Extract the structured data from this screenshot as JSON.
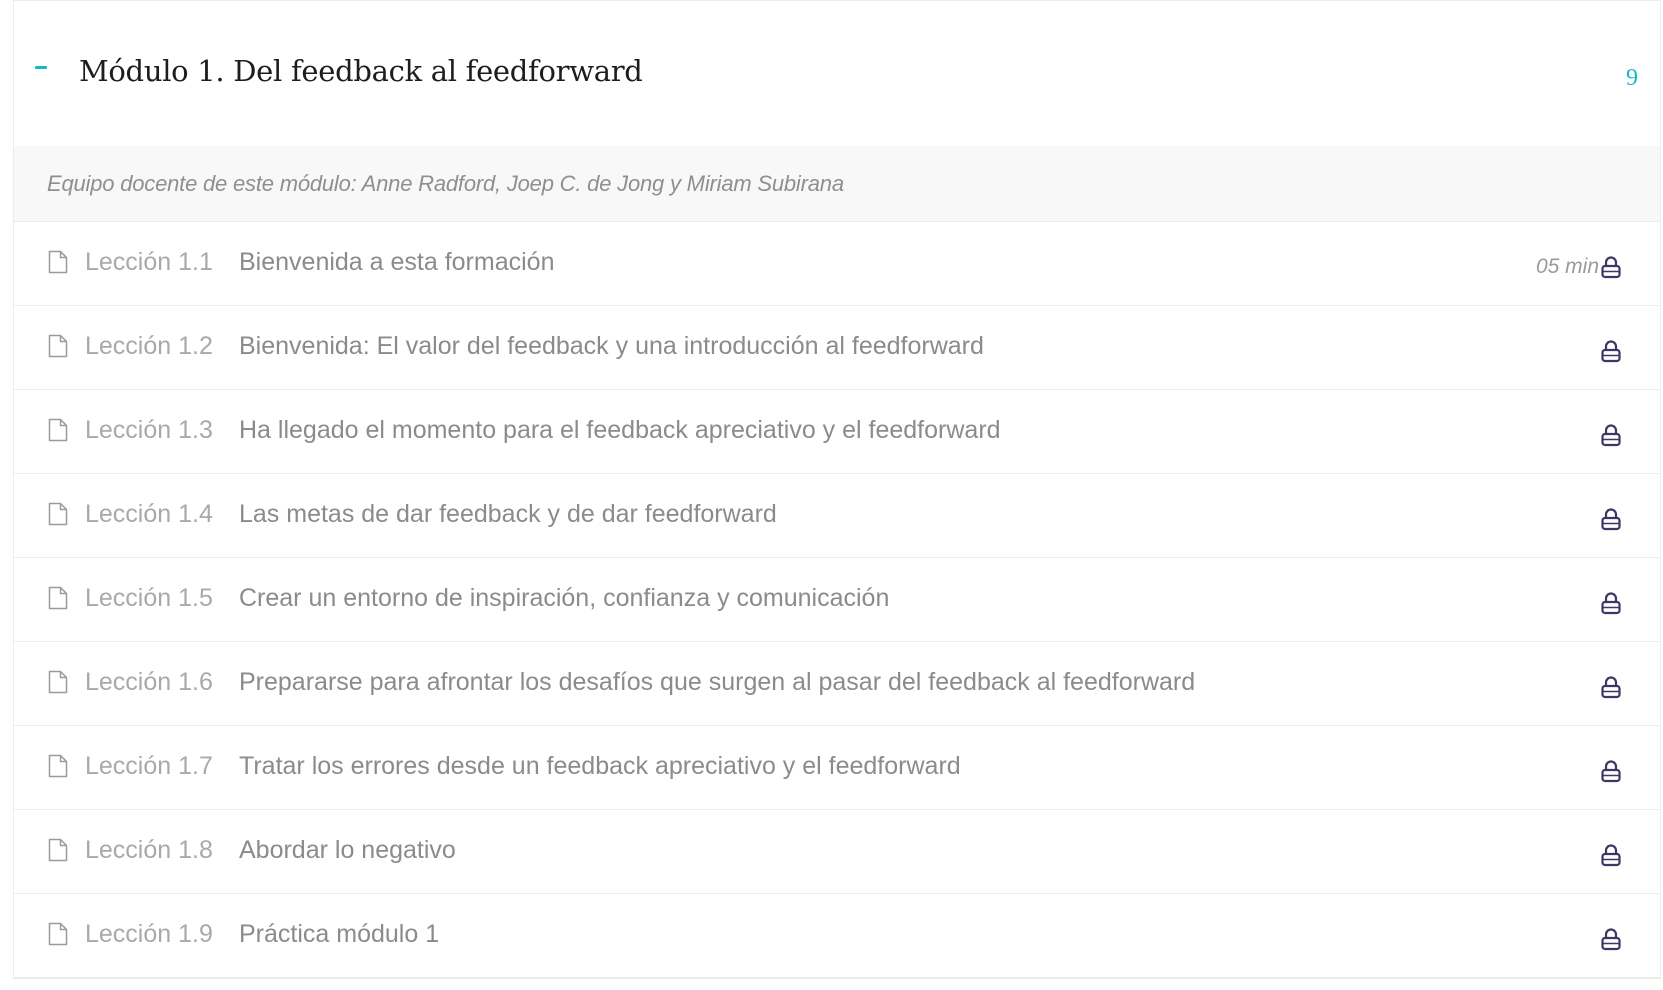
{
  "module": {
    "title": "Módulo 1. Del feedback al feedforward",
    "lesson_count": "9",
    "instructors": "Equipo docente de este módulo: Anne Radford, Joep C. de Jong y Miriam Subirana",
    "accent_color": "#17b7c8",
    "lessons": [
      {
        "label": "Lección 1.1",
        "title": "Bienvenida a esta formación",
        "duration": "05 min",
        "icon": "document-icon",
        "status_icon": "lock-icon"
      },
      {
        "label": "Lección 1.2",
        "title": "Bienvenida: El valor del feedback y una introducción al feedforward",
        "duration": "",
        "icon": "document-icon",
        "status_icon": "lock-icon"
      },
      {
        "label": "Lección 1.3",
        "title": "Ha llegado el momento para el feedback apreciativo y el feedforward",
        "duration": "",
        "icon": "document-icon",
        "status_icon": "lock-icon"
      },
      {
        "label": "Lección 1.4",
        "title": "Las metas de dar feedback y de dar feedforward",
        "duration": "",
        "icon": "document-icon",
        "status_icon": "lock-icon"
      },
      {
        "label": "Lección 1.5",
        "title": "Crear un entorno de inspiración, confianza y comunicación",
        "duration": "",
        "icon": "document-icon",
        "status_icon": "lock-icon"
      },
      {
        "label": "Lección 1.6",
        "title": "Prepararse para afrontar los desafíos que surgen al pasar del feedback al feedforward",
        "duration": "",
        "icon": "document-icon",
        "status_icon": "lock-icon"
      },
      {
        "label": "Lección 1.7",
        "title": "Tratar los errores desde un feedback apreciativo y el feedforward",
        "duration": "",
        "icon": "document-icon",
        "status_icon": "lock-icon"
      },
      {
        "label": "Lección 1.8",
        "title": "Abordar lo negativo",
        "duration": "",
        "icon": "document-icon",
        "status_icon": "lock-icon"
      },
      {
        "label": "Lección 1.9",
        "title": "Práctica módulo 1",
        "duration": "",
        "icon": "document-icon",
        "status_icon": "lock-icon"
      }
    ]
  }
}
